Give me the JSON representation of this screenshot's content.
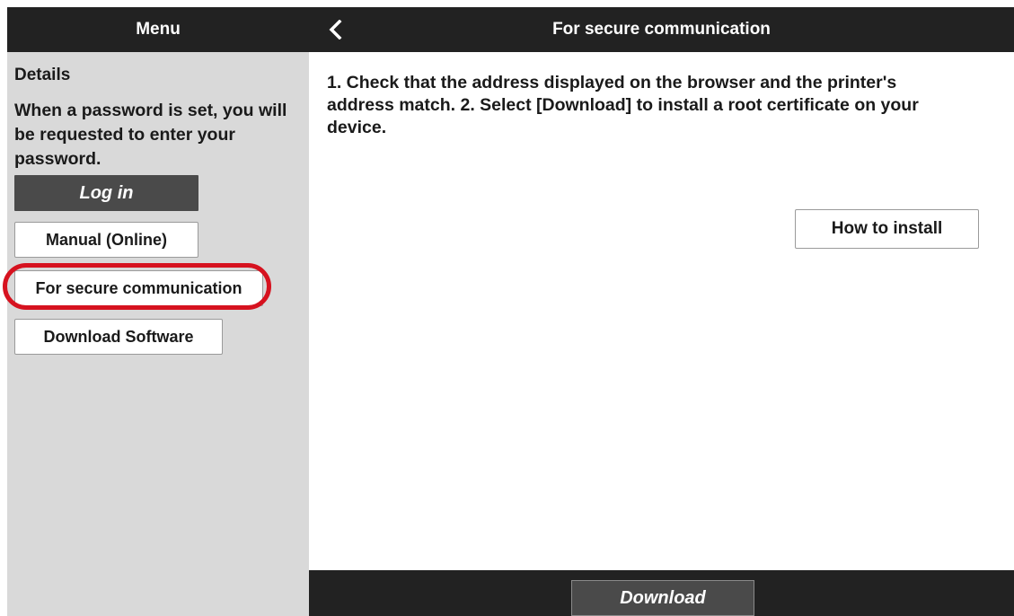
{
  "sidebar": {
    "header_title": "Menu",
    "details_title": "Details",
    "details_text": "When a password is set, you will be requested to enter your password.",
    "login_label": "Log in",
    "buttons": [
      {
        "label": "Manual (Online)"
      },
      {
        "label": "For secure communication",
        "highlighted": true
      },
      {
        "label": "Download Software"
      }
    ]
  },
  "header": {
    "back_icon": "chevron-left-icon",
    "title": "For secure communication"
  },
  "main": {
    "instructions": "1. Check that the address displayed on the browser and the printer's address match. 2. Select [Download] to install a root certificate on your device.",
    "how_to_install_label": "How to install"
  },
  "footer": {
    "download_label": "Download"
  },
  "colors": {
    "header_bg": "#222222",
    "sidebar_bg": "#d9d9d9",
    "dark_button": "#4a4a4a",
    "highlight": "#d6121f"
  }
}
